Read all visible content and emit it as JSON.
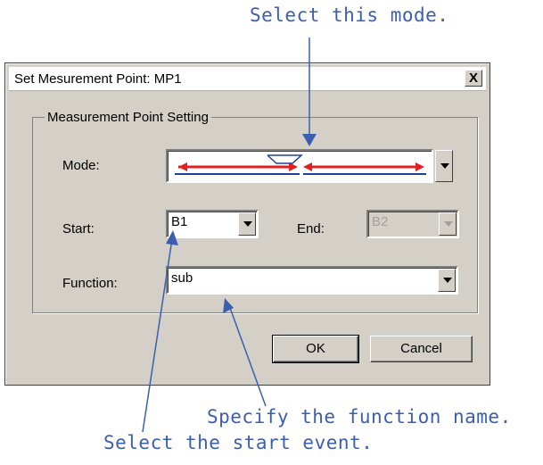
{
  "callouts": {
    "mode": "Select this mode.",
    "function": "Specify the function name.",
    "start": "Select the start event."
  },
  "dialog": {
    "title": "Set Mesurement Point: MP1",
    "close_label": "X",
    "group_label": "Measurement Point Setting",
    "mode_label": "Mode:",
    "start_label": "Start:",
    "start_value": "B1",
    "end_label": "End:",
    "end_value": "B2",
    "function_label": "Function:",
    "function_value": "sub",
    "ok_label": "OK",
    "cancel_label": "Cancel"
  },
  "colors": {
    "dialog_bg": "#d4d0c8",
    "callout": "#3a5fb0",
    "mode_arrow_red": "#e02020",
    "mode_arrow_blue": "#2040a0"
  },
  "icons": {
    "mode_glyph": "start-to-end-arrows-icon",
    "dropdown": "chevron-down-icon"
  }
}
